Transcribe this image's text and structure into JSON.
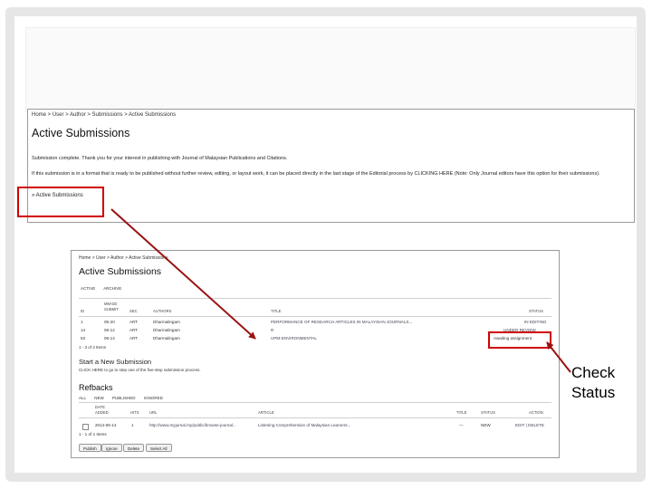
{
  "slide": {
    "callout_text": "Check Status",
    "highlight_color": "#d00000"
  },
  "screenshot1": {
    "breadcrumb": "Home > User > Author > Submissions > Active Submissions",
    "title": "Active Submissions",
    "message_1": "Submission complete. Thank you for your interest in publishing with Journal of Malaysian Publications and Citations.",
    "message_2": "If this submission is in a format that is ready to be published without further review, editing, or layout work, it can be placed directly in the last stage of the Editorial process by CLICKING HERE (Note: Only Journal editors have this option for their submissions).",
    "link": "» Active Submissions"
  },
  "screenshot2": {
    "breadcrumb": "Home > User > Author > Active Submissions",
    "title": "Active Submissions",
    "tabs": [
      "ACTIVE",
      "ARCHIVE"
    ],
    "columns": [
      "ID",
      "MM-DD SUBMIT",
      "SEC",
      "AUTHORS",
      "TITLE",
      "STATUS"
    ],
    "rows": [
      {
        "id": "1",
        "date": "05-20",
        "sec": "ART",
        "authors": "Dharmalingam",
        "title": "PERFORMANCE OF RESEARCH ARTICLES IN MALAYSIAN JOURNALS...",
        "status": "IN EDITING"
      },
      {
        "id": "14",
        "date": "06-12",
        "sec": "ART",
        "authors": "Dharmalingam",
        "title": "R",
        "status": "UNDER REVIEW"
      },
      {
        "id": "53",
        "date": "06-14",
        "sec": "ART",
        "authors": "Dharmalingam",
        "title": "UPM-ENVIRONMENTAL",
        "status": "Awaiting assignment"
      }
    ],
    "count_text": "1 - 3 of 3 Items",
    "new_submission_heading": "Start a New Submission",
    "new_submission_note": "CLICK HERE to go to step one of the five-step submission process.",
    "refbacks_heading": "Refbacks",
    "refback_tabs": [
      "ALL",
      "NEW",
      "PUBLISHED",
      "IGNORED"
    ],
    "refback_columns": [
      "DATE ADDED",
      "HITS",
      "URL",
      "ARTICLE",
      "TITLE",
      "STATUS",
      "ACTION"
    ],
    "refback_row": {
      "date": "2014-06-14",
      "hits": "1",
      "url": "http://www.myjurnal.my/public/browse-journal...",
      "article": "Listening Comprehension of Malaysian Learners...",
      "title": "—",
      "status": "NEW",
      "action": "EDIT | DELETE"
    },
    "refback_count": "1 - 1 of 1 Items",
    "buttons": [
      "Publish",
      "Ignore",
      "Delete",
      "Select All"
    ]
  }
}
